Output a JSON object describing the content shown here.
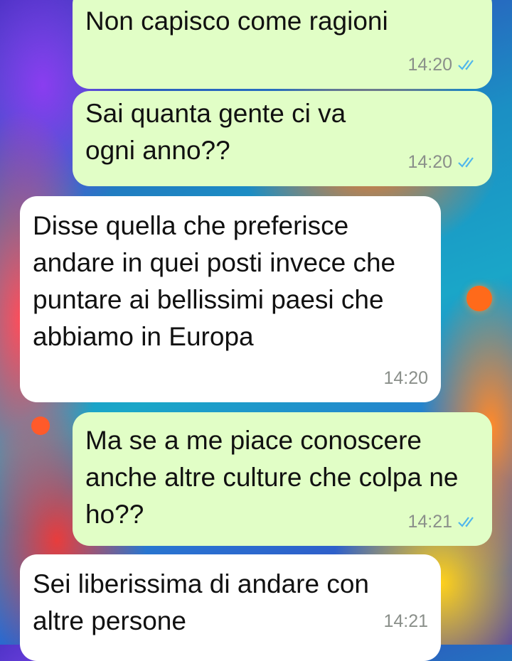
{
  "chat": {
    "messages": [
      {
        "direction": "outgoing",
        "text": "Non capisco come ragioni",
        "time": "14:20",
        "status": "read"
      },
      {
        "direction": "outgoing",
        "text": "Sai quanta gente ci va ogni anno??",
        "time": "14:20",
        "status": "read"
      },
      {
        "direction": "incoming",
        "text": "Disse quella che preferisce andare in quei posti invece che puntare ai bellissimi paesi che abbiamo in Europa",
        "time": "14:20"
      },
      {
        "direction": "outgoing",
        "text": "Ma se a me piace conoscere anche altre culture che colpa ne ho??",
        "time": "14:21",
        "status": "read"
      },
      {
        "direction": "incoming",
        "text": "Sei liberissima di andare con altre persone",
        "time": "14:21"
      }
    ]
  },
  "colors": {
    "outgoing_bubble": "#e1fec6",
    "incoming_bubble": "#ffffff",
    "read_ticks": "#4fb6ec",
    "timestamp": "#8a8f8a"
  },
  "icons": {
    "read_receipt": "double-check-icon"
  }
}
